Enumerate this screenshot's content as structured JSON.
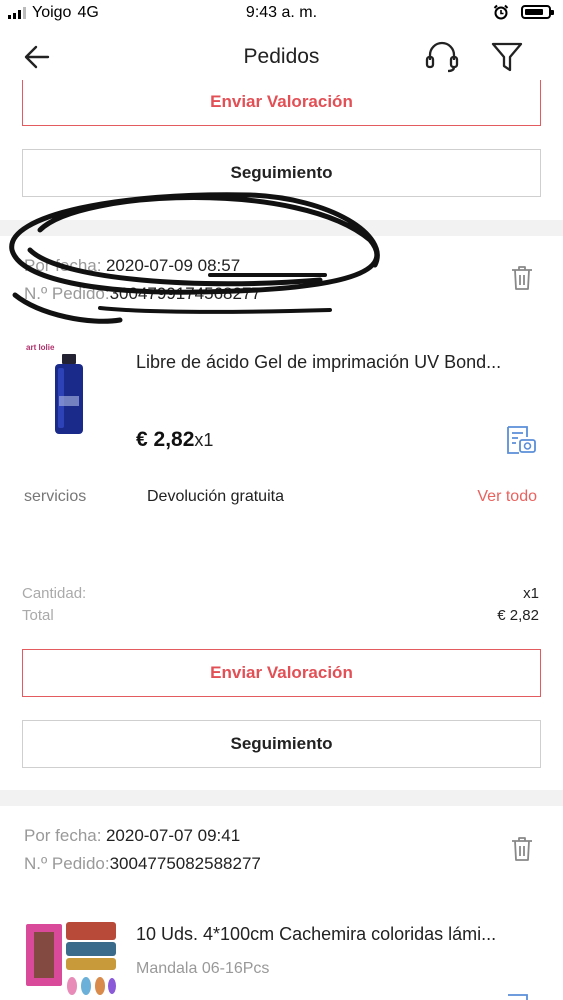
{
  "status_bar": {
    "carrier": "Yoigo",
    "network": "4G",
    "time": "9:43 a. m."
  },
  "header": {
    "title": "Pedidos",
    "icons": [
      "back-arrow-icon",
      "headset-icon",
      "filter-icon"
    ]
  },
  "top_partial": {
    "review_label": "Enviar Valoración",
    "tracking_label": "Seguimiento"
  },
  "orders": [
    {
      "date_label": "Por fecha:",
      "date_value": "2020-07-09 08:57",
      "order_label": "N.º Pedido:",
      "order_value": "3004799174568277",
      "product_title": "Libre de ácido Gel de imprimación UV Bond...",
      "brand_logo_text": "art lolie",
      "price": "€ 2,82",
      "quantity_suffix": "x1",
      "services_label": "servicios",
      "services_value": "Devolución gratuita",
      "view_all": "Ver todo",
      "quantity_label": "Cantidad:",
      "quantity_value": "x1",
      "total_label": "Total",
      "total_value": "€ 2,82",
      "review_label": "Enviar Valoración",
      "tracking_label": "Seguimiento"
    },
    {
      "date_label": "Por fecha:",
      "date_value": "2020-07-07 09:41",
      "order_label": "N.º Pedido:",
      "order_value": "3004775082588277",
      "product_title": "10 Uds. 4*100cm Cachemira coloridas lámi...",
      "variant": "Mandala 06-16Pcs"
    }
  ],
  "colors": {
    "accent": "#e24f55",
    "link": "#e9625e",
    "receipt_icon": "#5b8fd8",
    "divider": "#f2f2f2"
  }
}
